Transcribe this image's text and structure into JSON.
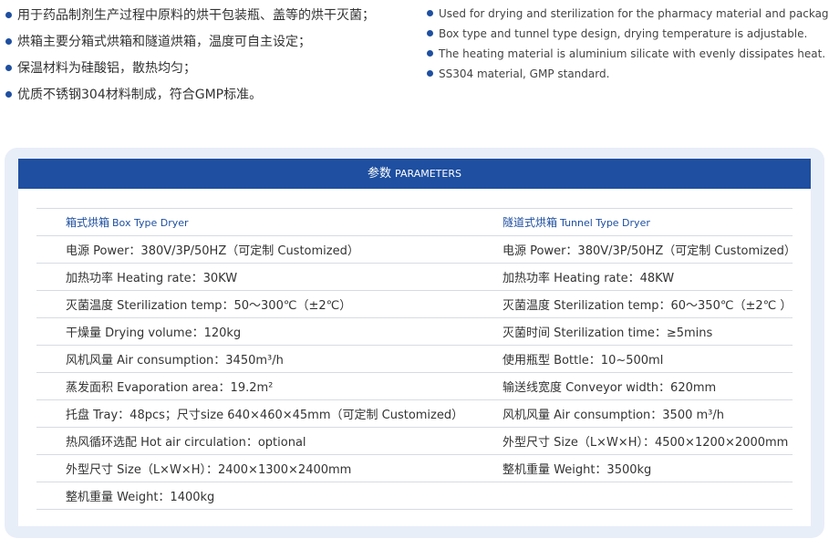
{
  "features_cn": [
    "用于药品制剂生产过程中原料的烘干包装瓶、盖等的烘干灭菌；",
    "烘箱主要分箱式烘箱和隧道烘箱，温度可自主设定；",
    "保温材料为硅酸铝，散热均匀；",
    "优质不锈钢304材料制成，符合GMP标准。"
  ],
  "features_en": [
    "Used for drying and sterilization for the pharmacy material and packages.",
    "Box type and tunnel type design, drying temperature is adjustable.",
    "The heating material is aluminium silicate with evenly dissipates heat.",
    "SS304 material, GMP standard."
  ],
  "colors": {
    "accent": "#1e4fa0",
    "panel_bg": "#e8eef8",
    "row_border": "#d7dbe2"
  },
  "params": {
    "title_cn": "参数",
    "title_en": "PARAMETERS",
    "box_header_cn": "箱式烘箱",
    "box_header_en": "Box Type Dryer",
    "tunnel_header_cn": "隧道式烘箱",
    "tunnel_header_en": "Tunnel Type Dryer",
    "rows": [
      {
        "left": "电源 Power：380V/3P/50HZ（可定制 Customized）",
        "right": "电源 Power：380V/3P/50HZ（可定制 Customized）"
      },
      {
        "left": "加热功率 Heating rate：30KW",
        "right": "加热功率 Heating rate：48KW"
      },
      {
        "left": "灭菌温度 Sterilization temp：50～300℃（±2℃）",
        "right": "灭菌温度 Sterilization temp：60～350℃（±2℃ ）"
      },
      {
        "left": "干燥量 Drying volume：120kg",
        "right": "灭菌时间 Sterilization time：≥5mins"
      },
      {
        "left": "风机风量 Air consumption：3450m³/h",
        "right": "使用瓶型 Bottle：10~500ml"
      },
      {
        "left": "蒸发面积 Evaporation area：19.2m²",
        "right": "输送线宽度 Conveyor width：620mm"
      },
      {
        "left": "托盘 Tray：48pcs；尺寸size 640×460×45mm（可定制 Customized）",
        "right": "风机风量 Air consumption：3500 m³/h"
      },
      {
        "left": "热风循环选配 Hot air circulation：optional",
        "right": "外型尺寸 Size（L×W×H）：4500×1200×2000mm"
      },
      {
        "left": "外型尺寸 Size（L×W×H）：2400×1300×2400mm",
        "right": "整机重量 Weight：3500kg"
      },
      {
        "left": "整机重量 Weight：1400kg",
        "right": ""
      }
    ]
  }
}
